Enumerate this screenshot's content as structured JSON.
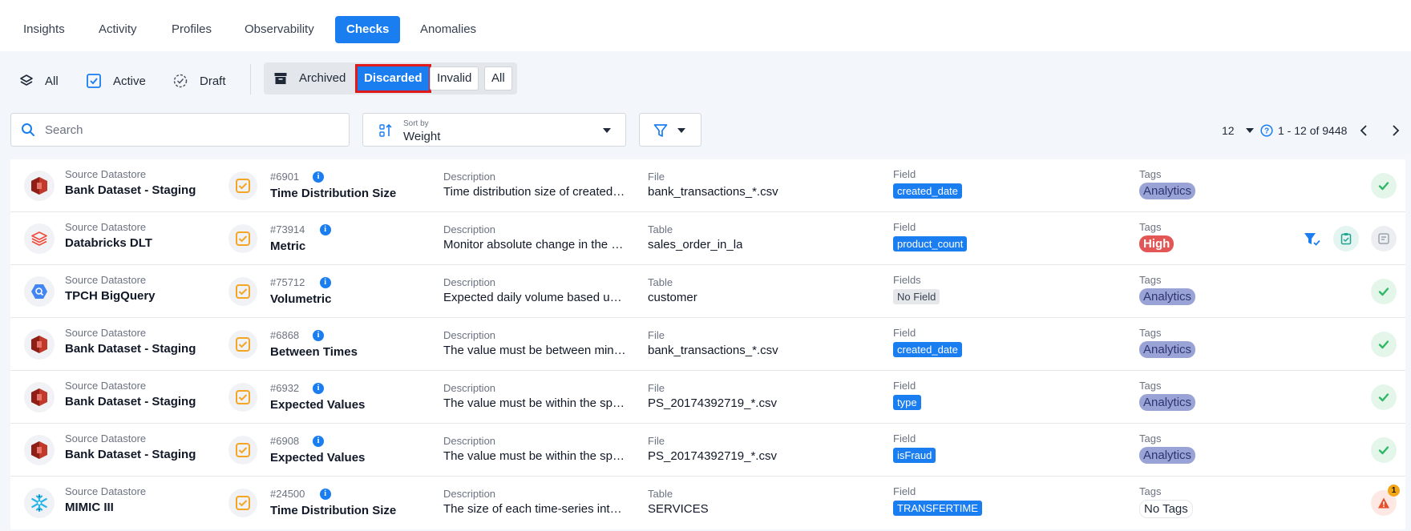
{
  "tabs": [
    "Insights",
    "Activity",
    "Profiles",
    "Observability",
    "Checks",
    "Anomalies"
  ],
  "active_tab": "Checks",
  "status_filters": {
    "all": "All",
    "active": "Active",
    "draft": "Draft"
  },
  "segments": {
    "archived": "Archived",
    "discarded": "Discarded",
    "invalid": "Invalid",
    "all": "All"
  },
  "search": {
    "placeholder": "Search"
  },
  "sort": {
    "label": "Sort by",
    "value": "Weight"
  },
  "pagination": {
    "page_size": "12",
    "range": "1 - 12 of 9448"
  },
  "rows": [
    {
      "datastore_label": "Source Datastore",
      "datastore": "Bank Dataset - Staging",
      "ds_icon": "redshift-icon",
      "check_id": "#6901",
      "check_type": "Time Distribution Size",
      "desc_label": "Description",
      "description": "Time distribution size of created_date",
      "container_label": "File",
      "container": "bank_transactions_*.csv",
      "field_label": "Field",
      "field": "created_date",
      "field_style": "field",
      "tags_label": "Tags",
      "tag": "Analytics",
      "tag_style": "analytics",
      "status": "ok"
    },
    {
      "datastore_label": "Source Datastore",
      "datastore": "Databricks DLT",
      "ds_icon": "databricks-icon",
      "check_id": "#73914",
      "check_type": "Metric",
      "desc_label": "Description",
      "description": "Monitor absolute change in the metric",
      "container_label": "Table",
      "container": "sales_order_in_la",
      "field_label": "Field",
      "field": "product_count",
      "field_style": "field",
      "tags_label": "Tags",
      "tag": "High",
      "tag_style": "high",
      "status": "actions"
    },
    {
      "datastore_label": "Source Datastore",
      "datastore": "TPCH BigQuery",
      "ds_icon": "bigquery-icon",
      "check_id": "#75712",
      "check_type": "Volumetric",
      "desc_label": "Description",
      "description": "Expected daily volume based upon history",
      "container_label": "Table",
      "container": "customer",
      "field_label": "Fields",
      "field": "No Field",
      "field_style": "nofield",
      "tags_label": "Tags",
      "tag": "Analytics",
      "tag_style": "analytics",
      "status": "ok"
    },
    {
      "datastore_label": "Source Datastore",
      "datastore": "Bank Dataset - Staging",
      "ds_icon": "redshift-icon",
      "check_id": "#6868",
      "check_type": "Between Times",
      "desc_label": "Description",
      "description": "The value must be between minTime and maxTime",
      "container_label": "File",
      "container": "bank_transactions_*.csv",
      "field_label": "Field",
      "field": "created_date",
      "field_style": "field",
      "tags_label": "Tags",
      "tag": "Analytics",
      "tag_style": "analytics",
      "status": "ok"
    },
    {
      "datastore_label": "Source Datastore",
      "datastore": "Bank Dataset - Staging",
      "ds_icon": "redshift-icon",
      "check_id": "#6932",
      "check_type": "Expected Values",
      "desc_label": "Description",
      "description": "The value must be within the specified list",
      "container_label": "File",
      "container": "PS_20174392719_*.csv",
      "field_label": "Field",
      "field": "type",
      "field_style": "field",
      "tags_label": "Tags",
      "tag": "Analytics",
      "tag_style": "analytics",
      "status": "ok"
    },
    {
      "datastore_label": "Source Datastore",
      "datastore": "Bank Dataset - Staging",
      "ds_icon": "redshift-icon",
      "check_id": "#6908",
      "check_type": "Expected Values",
      "desc_label": "Description",
      "description": "The value must be within the specified list",
      "container_label": "File",
      "container": "PS_20174392719_*.csv",
      "field_label": "Field",
      "field": "isFraud",
      "field_style": "field",
      "tags_label": "Tags",
      "tag": "Analytics",
      "tag_style": "analytics",
      "status": "ok"
    },
    {
      "datastore_label": "Source Datastore",
      "datastore": "MIMIC III",
      "ds_icon": "snowflake-icon",
      "check_id": "#24500",
      "check_type": "Time Distribution Size",
      "desc_label": "Description",
      "description": "The size of each time-series interval",
      "container_label": "Table",
      "container": "SERVICES",
      "field_label": "Field",
      "field": "TRANSFERTIME",
      "field_style": "field",
      "tags_label": "Tags",
      "tag": "No Tags",
      "tag_style": "notags",
      "status": "warn",
      "badge": "1"
    }
  ],
  "colors": {
    "accent": "#1a7df0",
    "highlight": "#e01a1a",
    "check_icon": "#f5a524",
    "success": "#2fb865"
  }
}
